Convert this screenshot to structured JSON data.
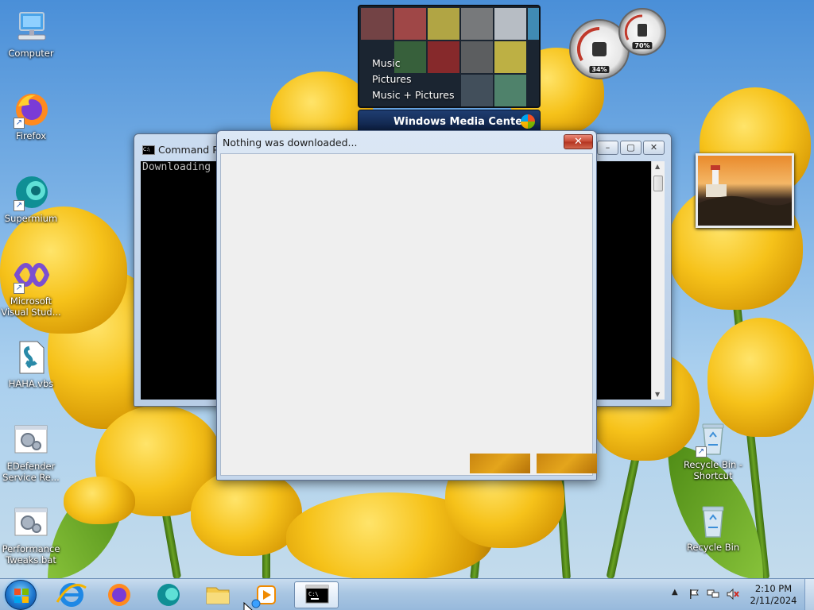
{
  "desktop_icons": [
    {
      "label": "Computer",
      "icon": "computer-icon"
    },
    {
      "label": "Firefox",
      "icon": "firefox-icon"
    },
    {
      "label": "Supermium",
      "icon": "supermium-icon"
    },
    {
      "label": "Microsoft Visual Stud...",
      "icon": "visual-studio-icon"
    },
    {
      "label": "HAHA.vbs",
      "icon": "vbs-script-icon"
    },
    {
      "label": "EDefender Service Re...",
      "icon": "batch-file-icon"
    },
    {
      "label": "Performance Tweaks.bat",
      "icon": "batch-file-icon"
    },
    {
      "label": "Recycle Bin - Shortcut",
      "icon": "recycle-bin-icon"
    },
    {
      "label": "Recycle Bin",
      "icon": "recycle-bin-icon"
    }
  ],
  "media_center": {
    "menu": [
      "Music",
      "Pictures",
      "Music + Pictures"
    ],
    "title": "Windows Media Center"
  },
  "gauges": {
    "cpu_percent": "34%",
    "memory_percent": "70%"
  },
  "cmd_window": {
    "title": "Command Pro",
    "output": "Downloading"
  },
  "dialog": {
    "title": "Nothing was downloaded...",
    "close_label": "✕"
  },
  "taskbar": {
    "items": [
      "internet-explorer-icon",
      "firefox-icon",
      "supermium-icon",
      "file-explorer-icon",
      "media-player-icon",
      "command-prompt-icon"
    ],
    "time": "2:10 PM",
    "date": "2/11/2024"
  }
}
